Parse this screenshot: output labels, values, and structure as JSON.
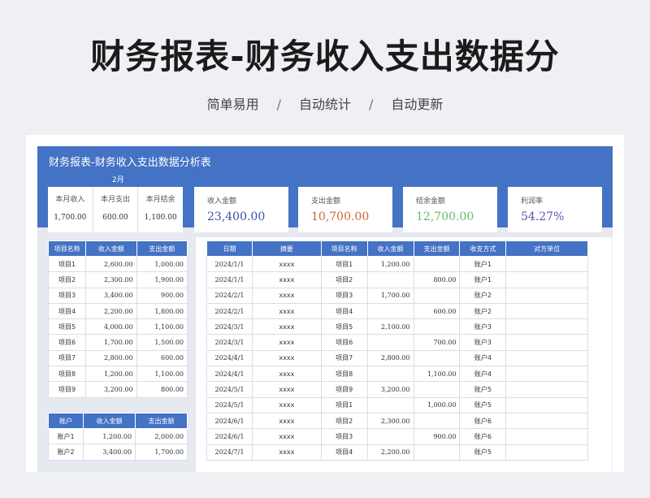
{
  "hero": {
    "title": "财务报表-财务收入支出数据分",
    "tags": [
      "简单易用",
      "自动统计",
      "自动更新"
    ],
    "separator": "/"
  },
  "sheet": {
    "title": "财务报表-财务收入支出数据分析表",
    "month_label": "2月",
    "month_summary": {
      "headers": [
        "本月收入",
        "本月支出",
        "本月结余"
      ],
      "values": [
        "1,700.00",
        "600.00",
        "1,100.00"
      ]
    },
    "kpis": [
      {
        "label": "收入金额",
        "value": "23,400.00",
        "color": "#3c4fa8"
      },
      {
        "label": "支出金额",
        "value": "10,700.00",
        "color": "#d2603a"
      },
      {
        "label": "结余金额",
        "value": "12,700.00",
        "color": "#5fbf6a"
      },
      {
        "label": "利润率",
        "value": "54.27%",
        "color": "#5a52b8"
      }
    ],
    "project_table": {
      "headers": [
        "项目名称",
        "收入金额",
        "支出金额"
      ],
      "rows": [
        [
          "项目1",
          "2,600.00",
          "1,000.00"
        ],
        [
          "项目2",
          "2,300.00",
          "1,900.00"
        ],
        [
          "项目3",
          "3,400.00",
          "900.00"
        ],
        [
          "项目4",
          "2,200.00",
          "1,800.00"
        ],
        [
          "项目5",
          "4,000.00",
          "1,100.00"
        ],
        [
          "项目6",
          "1,700.00",
          "1,500.00"
        ],
        [
          "项目7",
          "2,800.00",
          "600.00"
        ],
        [
          "项目8",
          "1,200.00",
          "1,100.00"
        ],
        [
          "项目9",
          "3,200.00",
          "800.00"
        ]
      ]
    },
    "account_table": {
      "headers": [
        "账户",
        "收入金额",
        "支出金额"
      ],
      "rows": [
        [
          "账户1",
          "1,200.00",
          "2,000.00"
        ],
        [
          "账户2",
          "3,400.00",
          "1,700.00"
        ]
      ]
    },
    "detail_table": {
      "headers": [
        "日期",
        "摘要",
        "项目名称",
        "收入金额",
        "支出金额",
        "收支方式",
        "对方单位"
      ],
      "rows": [
        [
          "2024/1/1",
          "xxxx",
          "项目1",
          "1,200.00",
          "",
          "账户1",
          ""
        ],
        [
          "2024/1/1",
          "xxxx",
          "项目2",
          "",
          "800.00",
          "账户1",
          ""
        ],
        [
          "2024/2/1",
          "xxxx",
          "项目3",
          "1,700.00",
          "",
          "账户2",
          ""
        ],
        [
          "2024/2/1",
          "xxxx",
          "项目4",
          "",
          "600.00",
          "账户2",
          ""
        ],
        [
          "2024/3/1",
          "xxxx",
          "项目5",
          "2,100.00",
          "",
          "账户3",
          ""
        ],
        [
          "2024/3/1",
          "xxxx",
          "项目6",
          "",
          "700.00",
          "账户3",
          ""
        ],
        [
          "2024/4/1",
          "xxxx",
          "项目7",
          "2,800.00",
          "",
          "账户4",
          ""
        ],
        [
          "2024/4/1",
          "xxxx",
          "项目8",
          "",
          "1,100.00",
          "账户4",
          ""
        ],
        [
          "2024/5/1",
          "xxxx",
          "项目9",
          "3,200.00",
          "",
          "账户5",
          ""
        ],
        [
          "2024/5/1",
          "xxxx",
          "项目1",
          "",
          "1,000.00",
          "账户5",
          ""
        ],
        [
          "2024/6/1",
          "xxxx",
          "项目2",
          "2,300.00",
          "",
          "账户6",
          ""
        ],
        [
          "2024/6/1",
          "xxxx",
          "项目3",
          "",
          "900.00",
          "账户6",
          ""
        ],
        [
          "2024/7/1",
          "xxxx",
          "项目4",
          "2,200.00",
          "",
          "账户5",
          ""
        ]
      ]
    }
  }
}
